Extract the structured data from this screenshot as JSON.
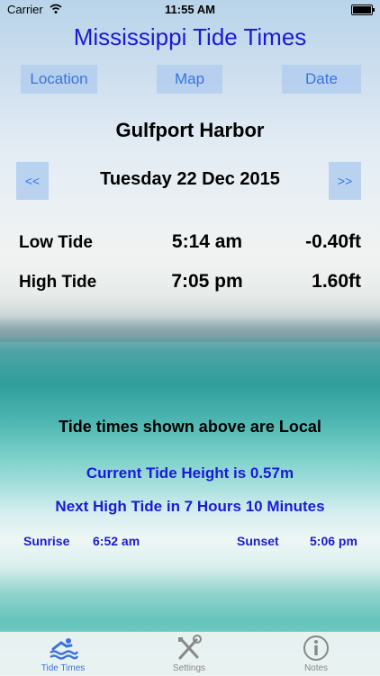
{
  "status_bar": {
    "carrier": "Carrier",
    "time": "11:55 AM"
  },
  "app_title": "Mississippi Tide Times",
  "buttons": {
    "location": "Location",
    "map": "Map",
    "date": "Date"
  },
  "location_name": "Gulfport Harbor",
  "date_nav": {
    "prev": "<<",
    "date": "Tuesday 22 Dec 2015",
    "next": ">>"
  },
  "tides": [
    {
      "type": "Low Tide",
      "time": "5:14 am",
      "height": "-0.40ft"
    },
    {
      "type": "High Tide",
      "time": "7:05 pm",
      "height": "1.60ft"
    }
  ],
  "local_note": "Tide times shown above are Local",
  "current_height": "Current Tide Height is 0.57m",
  "next_high": "Next High Tide in 7 Hours 10 Minutes",
  "sun": {
    "sunrise_label": "Sunrise",
    "sunrise_time": "6:52 am",
    "sunset_label": "Sunset",
    "sunset_time": "5:06 pm"
  },
  "tabs": [
    {
      "label": "Tide Times",
      "icon": "swimmer-icon",
      "active": true
    },
    {
      "label": "Settings",
      "icon": "tools-icon",
      "active": false
    },
    {
      "label": "Notes",
      "icon": "info-icon",
      "active": false
    }
  ],
  "colors": {
    "title_blue": "#1a1ad8",
    "button_blue": "#3a73e0",
    "tab_inactive": "#888888"
  }
}
